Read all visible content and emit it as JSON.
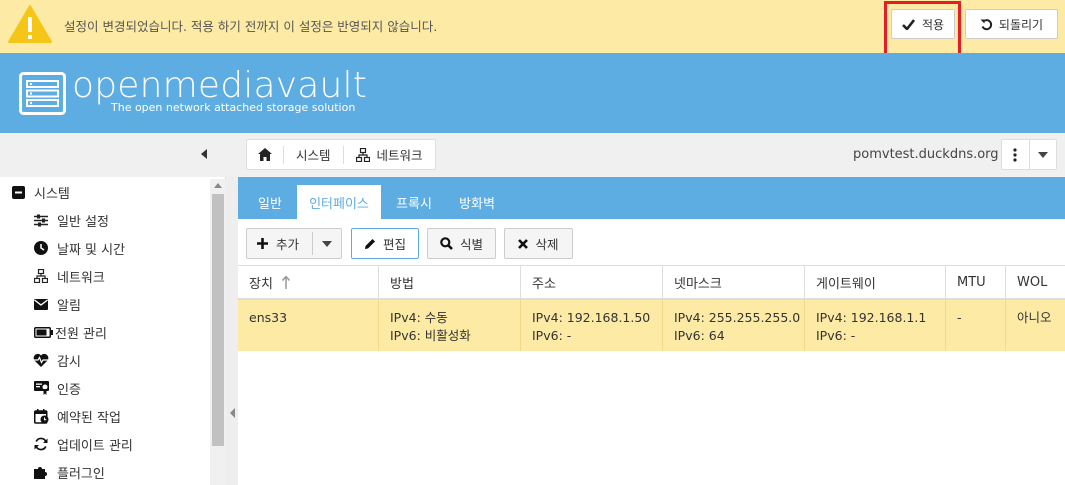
{
  "notice": {
    "message": "설정이 변경되었습니다. 적용 하기 전까지 이 설정은 반영되지 않습니다.",
    "apply_label": "적용",
    "revert_label": "되돌리기"
  },
  "header": {
    "logo_text": "openmediavault",
    "logo_subtitle": "The open network attached storage solution"
  },
  "breadcrumb": {
    "items": [
      "시스템",
      "네트워크"
    ]
  },
  "hostname": "pomvtest.duckdns.org",
  "sidebar": {
    "items": [
      {
        "label": "시스템",
        "icon": "minus-square-icon"
      },
      {
        "label": "일반 설정",
        "icon": "sliders-icon"
      },
      {
        "label": "날짜 및 시간",
        "icon": "clock-icon"
      },
      {
        "label": "네트워크",
        "icon": "network-icon"
      },
      {
        "label": "알림",
        "icon": "envelope-icon"
      },
      {
        "label": "전원 관리",
        "icon": "battery-icon"
      },
      {
        "label": "감시",
        "icon": "heartbeat-icon"
      },
      {
        "label": "인증",
        "icon": "certificate-icon"
      },
      {
        "label": "예약된 작업",
        "icon": "calendar-clock-icon"
      },
      {
        "label": "업데이트 관리",
        "icon": "refresh-icon"
      },
      {
        "label": "플러그인",
        "icon": "puzzle-icon"
      }
    ]
  },
  "tabs": [
    "일반",
    "인터페이스",
    "프록시",
    "방화벽"
  ],
  "active_tab": "인터페이스",
  "grid_toolbar": {
    "add": "추가",
    "edit": "편집",
    "identify": "식별",
    "delete": "삭제"
  },
  "grid": {
    "columns": [
      "장치",
      "방법",
      "주소",
      "넷마스크",
      "게이트웨이",
      "MTU",
      "WOL"
    ],
    "rows": [
      {
        "device": "ens33",
        "method_v4": "IPv4: 수동",
        "method_v6": "IPv6: 비활성화",
        "address_v4": "IPv4: 192.168.1.50",
        "address_v6": "IPv6: -",
        "netmask_v4": "IPv4: 255.255.255.0",
        "netmask_v6": "IPv6: 64",
        "gateway_v4": "IPv4: 192.168.1.1",
        "gateway_v6": "IPv6: -",
        "mtu": "-",
        "wol": "아니오"
      }
    ]
  },
  "colors": {
    "accent": "#5dade2",
    "notice_bg": "#fdeaa5",
    "highlight": "#e31e24"
  }
}
